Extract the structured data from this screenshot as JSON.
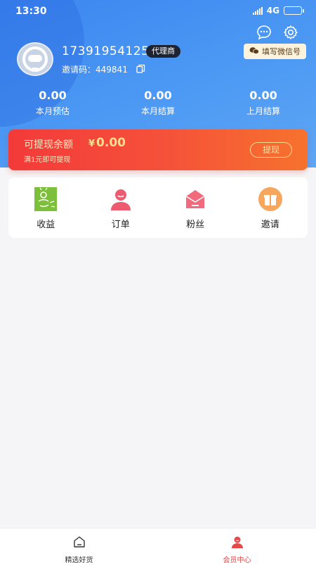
{
  "status_bar": {
    "time": "13:30",
    "network": "4G",
    "signal_icon": "signal-icon",
    "battery_icon": "battery-icon"
  },
  "header": {
    "message_icon": "chat-bubble-icon",
    "settings_icon": "gear-icon",
    "wechat_chip_label": "填写微信号",
    "wechat_chip_icon": "wechat-icon"
  },
  "profile": {
    "avatar_icon": "avatar-icon",
    "phone": "17391954125",
    "role": "代理商",
    "invite_label": "邀请码：",
    "invite_code": "449841",
    "copy_icon": "copy-icon"
  },
  "stats": [
    {
      "value": "0.00",
      "label": "本月预估"
    },
    {
      "value": "0.00",
      "label": "本月结算"
    },
    {
      "value": "0.00",
      "label": "上月结算"
    }
  ],
  "balance": {
    "title": "可提现余额",
    "currency": "¥",
    "amount": "0.00",
    "hint": "满1元即可提现",
    "withdraw_label": "提现"
  },
  "menu": [
    {
      "label": "收益",
      "icon": "earnings-icon"
    },
    {
      "label": "订单",
      "icon": "orders-icon"
    },
    {
      "label": "粉丝",
      "icon": "fans-icon"
    },
    {
      "label": "邀请",
      "icon": "invite-icon"
    }
  ],
  "tabbar": [
    {
      "label": "精选好货",
      "icon": "home-icon",
      "active": false
    },
    {
      "label": "会员中心",
      "icon": "member-icon",
      "active": true
    }
  ],
  "colors": {
    "header_blue": "#3a86f0",
    "balance_red": "#f33a3a",
    "balance_orange": "#f7722d",
    "active_tab": "#e44848"
  }
}
